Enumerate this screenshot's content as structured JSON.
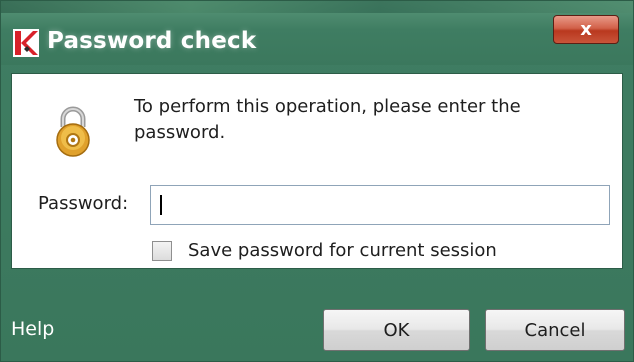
{
  "window": {
    "title": "Password check",
    "close_glyph": "x",
    "icons": {
      "app": "kaspersky-logo-icon",
      "close": "close-icon"
    }
  },
  "content": {
    "message": "To perform this operation, please enter the password.",
    "lock_icon": "padlock-icon",
    "password": {
      "label": "Password:",
      "value": "",
      "placeholder": ""
    },
    "save_session": {
      "label": "Save password for current session",
      "checked": false
    }
  },
  "footer": {
    "help_label": "Help",
    "ok_label": "OK",
    "cancel_label": "Cancel"
  },
  "colors": {
    "frame": "#3f7d62",
    "close_button": "#c9553a",
    "content_bg": "#ffffff"
  }
}
